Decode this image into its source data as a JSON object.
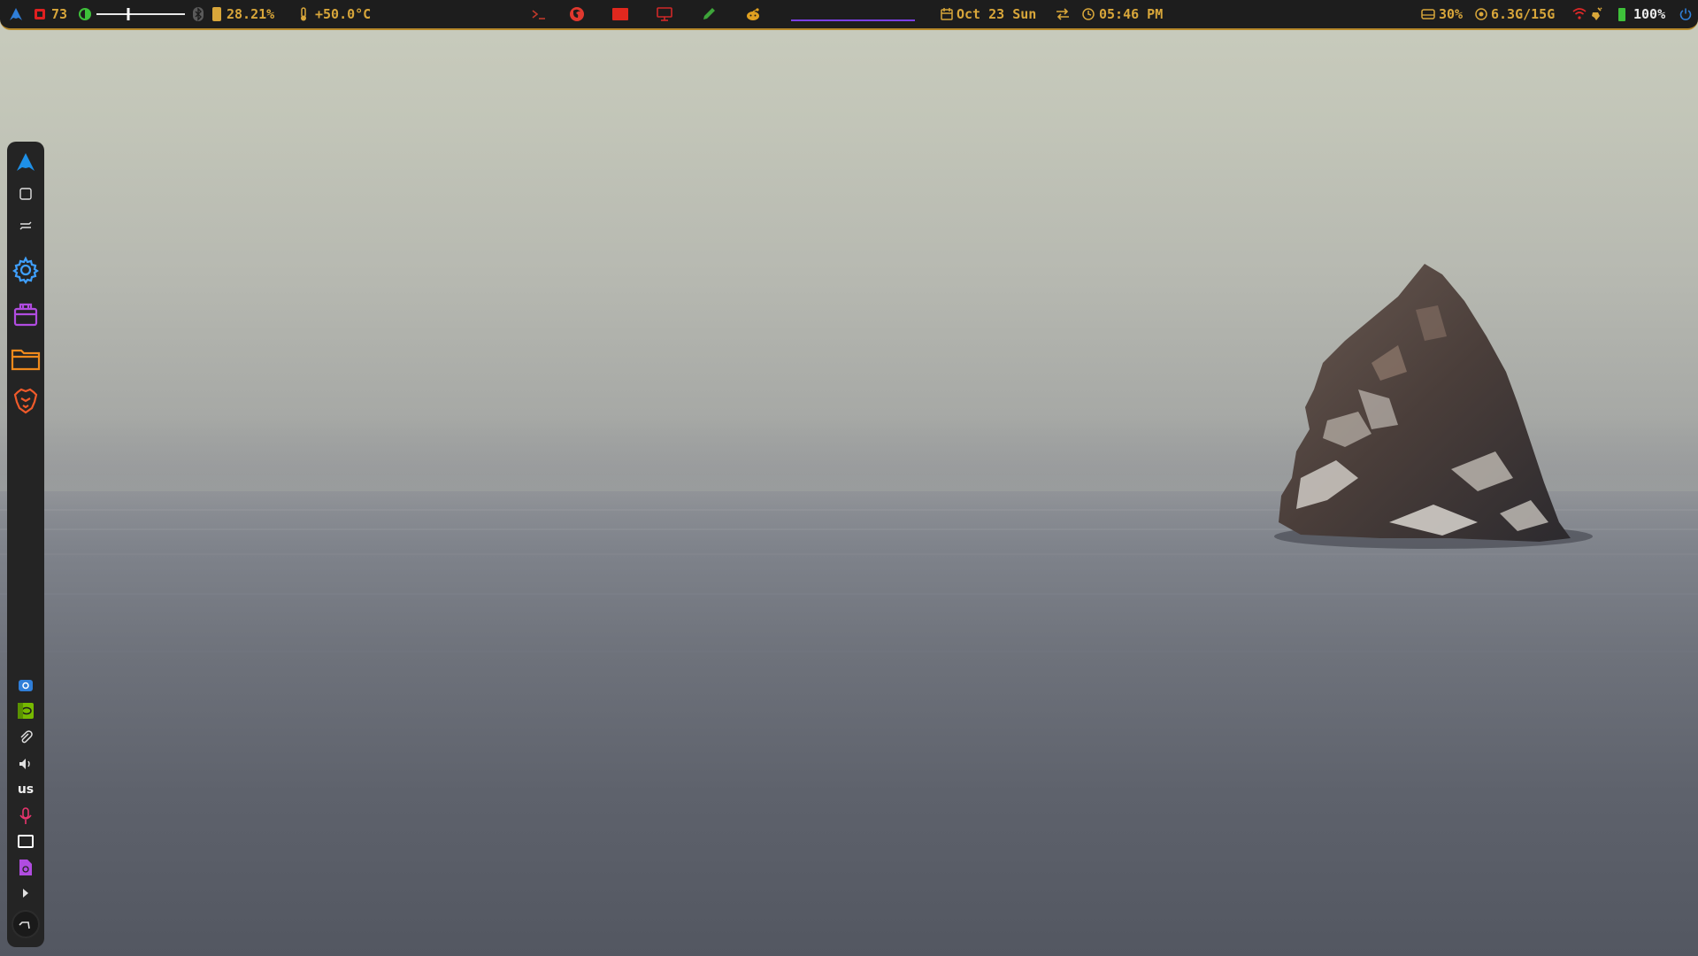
{
  "topbar": {
    "cpu_value": "73",
    "cpu_freq_value": "28.21%",
    "temperature": "+50.0°C",
    "date": "Oct 23 Sun",
    "time": "05:46 PM",
    "disk_usage": "30%",
    "memory": "6.3G/15G",
    "battery": "100%",
    "workspaces": [
      {
        "icon": "terminal-icon",
        "color": "#c0392b"
      },
      {
        "icon": "firefox-icon",
        "color": "#e0382e"
      },
      {
        "icon": "mail-icon",
        "color": "#e0281e"
      },
      {
        "icon": "monitor-icon",
        "color": "#d02828"
      },
      {
        "icon": "editor-icon",
        "color": "#3ea53a"
      },
      {
        "icon": "reddit-icon",
        "color": "#e0a020"
      }
    ],
    "active_workspace_color": "#7b3fe4",
    "accent_color": "#d8a63a",
    "bar_border_color": "#b78a2b"
  },
  "dock": {
    "apps": [
      {
        "name": "arch-launcher-icon",
        "color": "#1e90e8"
      },
      {
        "name": "window-icon",
        "color": "#e0e0e0"
      },
      {
        "name": "switch-icon",
        "color": "#e0e0e0"
      },
      {
        "name": "settings-gear-icon",
        "color": "#3fa0ff"
      },
      {
        "name": "software-store-icon",
        "color": "#b04ce0"
      },
      {
        "name": "file-manager-icon",
        "color": "#f08a1c"
      },
      {
        "name": "brave-browser-icon",
        "color": "#f05a2a"
      }
    ],
    "tray": {
      "keyboard_layout": "us"
    }
  }
}
